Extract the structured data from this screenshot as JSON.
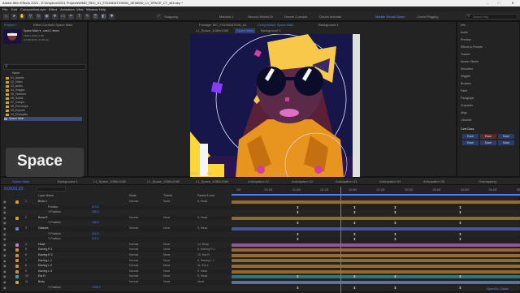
{
  "window": {
    "title": "Adobe After Effects 2021 - E:\\Dropbox\\2021 Projects\\MMD_REC_01_FOUNDATION\\04_AE\\MMD_L1_SPACE_C7_all3.aep *"
  },
  "menu": [
    "File",
    "Edit",
    "Composition",
    "Layer",
    "Effect",
    "Animation",
    "View",
    "Window",
    "Help"
  ],
  "toolbar": {
    "snapping": "Snapping"
  },
  "workspaces": {
    "tabs": [
      "Marvels 1",
      "Nexxon Nextel-Di",
      "Dream 1 people",
      "Dream animate",
      "Marble Recall Game",
      "Comet Rigging"
    ],
    "active_index": 4,
    "search_placeholder": "Search Help"
  },
  "project": {
    "tab": "Project ≡",
    "effect_controls_tab": "Effect Controls Space Main",
    "item_name": "Space Main ▾ , used 1 times",
    "item_info": [
      "1920 x 1080 (1.00)",
      "Δ 0;00;10;00, 24.00 fps"
    ],
    "search_placeholder": "",
    "list_header": "Name",
    "items": [
      "01_Assets",
      "02_Video",
      "03_Audio",
      "04_Images",
      "05_Textures",
      "06_Solids",
      "07_Comps",
      "08_Precomps",
      "09_Exports",
      "10_Examples",
      "Space Main"
    ],
    "selected_index": 10,
    "thumb_label": "Space"
  },
  "comp": {
    "tab_layer": "Footage: MC_FOUNDATION_A1",
    "tab_main": "Composition Space Main",
    "tab_bg": "Background 1",
    "subtabs": [
      "L1_Space_1080x1080",
      "Space Main",
      "Background 1"
    ],
    "active_subtab": 1,
    "zoom": "100%",
    "quality": "Full",
    "timecode": "0;00;01;22"
  },
  "right_panel": {
    "items": [
      "Info",
      "Audio",
      "Preview",
      "Effects & Presets",
      "Tracker",
      "Motion Sketch",
      "Smoother",
      "Wiggler",
      "Brushes",
      "Paint",
      "Paragraph",
      "Character",
      "Align",
      "Libraries",
      "OverClass"
    ],
    "ease_buttons": [
      "Ease",
      "Ease",
      "Ease",
      "Ease",
      "Ease",
      "Ease"
    ]
  },
  "timeline": {
    "tabs": [
      "Space Main",
      "Background 1",
      "L1_Space_1080x1080",
      "L1_Space_1080x1080",
      "L1_Space_1080x1080",
      "Anticipation 01",
      "Anticipation 02",
      "Anticipation 03",
      "Anticipation 04",
      "Anticipation 05",
      "Overlapping"
    ],
    "active_tab": 0,
    "timecode": "0;00;01;22",
    "headers": {
      "name": "Layer Name",
      "mode": "Mode",
      "trkmat": "TrkMat",
      "parent": "Parent & Link"
    },
    "ruler": [
      "00f",
      "00:12f",
      "01:00f",
      "01:12f",
      "02:00f",
      "02:12f",
      "03:00f",
      "03:12f",
      "04:00f",
      "04:12f",
      "05:00f"
    ],
    "rows": [
      {
        "num": "1",
        "name": "Brow 1",
        "mode": "Normal",
        "trk": "None",
        "par": "5. Head",
        "value": "",
        "color": "#c9a23a",
        "bar": "#b8862a",
        "kf": []
      },
      {
        "num": "",
        "name": "Position",
        "mode": "",
        "trk": "",
        "par": "",
        "value": "672.0",
        "color": "",
        "bar": "",
        "kf": [
          80,
          150,
          200,
          280
        ]
      },
      {
        "num": "",
        "name": "Y Position",
        "mode": "",
        "trk": "",
        "par": "",
        "value": "286.0",
        "color": "",
        "bar": "",
        "kf": [
          80,
          150,
          200,
          280
        ]
      },
      {
        "num": "2",
        "name": "Brow R",
        "mode": "Normal",
        "trk": "None",
        "par": "5. Head",
        "value": "",
        "color": "#c9a23a",
        "bar": "#b8862a",
        "kf": []
      },
      {
        "num": "",
        "name": "Y Position",
        "mode": "",
        "trk": "",
        "par": "",
        "value": "198.0",
        "color": "",
        "bar": "",
        "kf": [
          80,
          150,
          200,
          280
        ]
      },
      {
        "num": "3",
        "name": "Glasses",
        "mode": "Normal",
        "trk": "None",
        "par": "5. Head",
        "value": "",
        "color": "#7080c0",
        "bar": "#5a66c8",
        "kf": []
      },
      {
        "num": "",
        "name": "Y Position",
        "mode": "",
        "trk": "",
        "par": "",
        "value": "421.5",
        "color": "",
        "bar": "",
        "kf": [
          80,
          150,
          200,
          280
        ]
      },
      {
        "num": "",
        "name": "Y Position",
        "mode": "",
        "trk": "",
        "par": "",
        "value": "611.5",
        "color": "",
        "bar": "",
        "kf": [
          80,
          150,
          200,
          280
        ]
      },
      {
        "num": "4",
        "name": "Head",
        "mode": "Normal",
        "trk": "None",
        "par": "14. Body",
        "value": "",
        "color": "#c080c0",
        "bar": "#b06ac0",
        "kf": []
      },
      {
        "num": "5",
        "name": "Earring R 1",
        "mode": "Normal",
        "trk": "None",
        "par": "6. Earring R 2",
        "value": "",
        "color": "#d09040",
        "bar": "#c08030",
        "kf": []
      },
      {
        "num": "6",
        "name": "Earring R 2",
        "mode": "Normal",
        "trk": "None",
        "par": "10. Ear R",
        "value": "",
        "color": "#d09040",
        "bar": "#c08030",
        "kf": []
      },
      {
        "num": "7",
        "name": "Earring L 1",
        "mode": "Normal",
        "trk": "None",
        "par": "8. Earring L 2",
        "value": "",
        "color": "#d09040",
        "bar": "#c08030",
        "kf": []
      },
      {
        "num": "8",
        "name": "Earring L 2",
        "mode": "Normal",
        "trk": "None",
        "par": "11. Ear L",
        "value": "",
        "color": "#d09040",
        "bar": "#c08030",
        "kf": []
      },
      {
        "num": "9",
        "name": "Earring L 3",
        "mode": "Normal",
        "trk": "None",
        "par": "5. Head",
        "value": "",
        "color": "#d09040",
        "bar": "#c08030",
        "kf": []
      },
      {
        "num": "10",
        "name": "Ear R",
        "mode": "Normal",
        "trk": "None",
        "par": "5. Head",
        "value": "",
        "color": "#40a0b0",
        "bar": "#3090a0",
        "kf": [
          80,
          150,
          200,
          280
        ]
      },
      {
        "num": "11",
        "name": "Body",
        "mode": "Normal",
        "trk": "None",
        "par": "None",
        "value": "",
        "color": "#c9a23a",
        "bar": "#6a8cd0",
        "kf": []
      },
      {
        "num": "",
        "name": "Y Position",
        "mode": "",
        "trk": "",
        "par": "",
        "value": "1295.0",
        "color": "",
        "bar": "",
        "kf": [
          80,
          150,
          200,
          280
        ]
      }
    ]
  },
  "footer": {
    "brand": "OpenGL Cloud"
  }
}
